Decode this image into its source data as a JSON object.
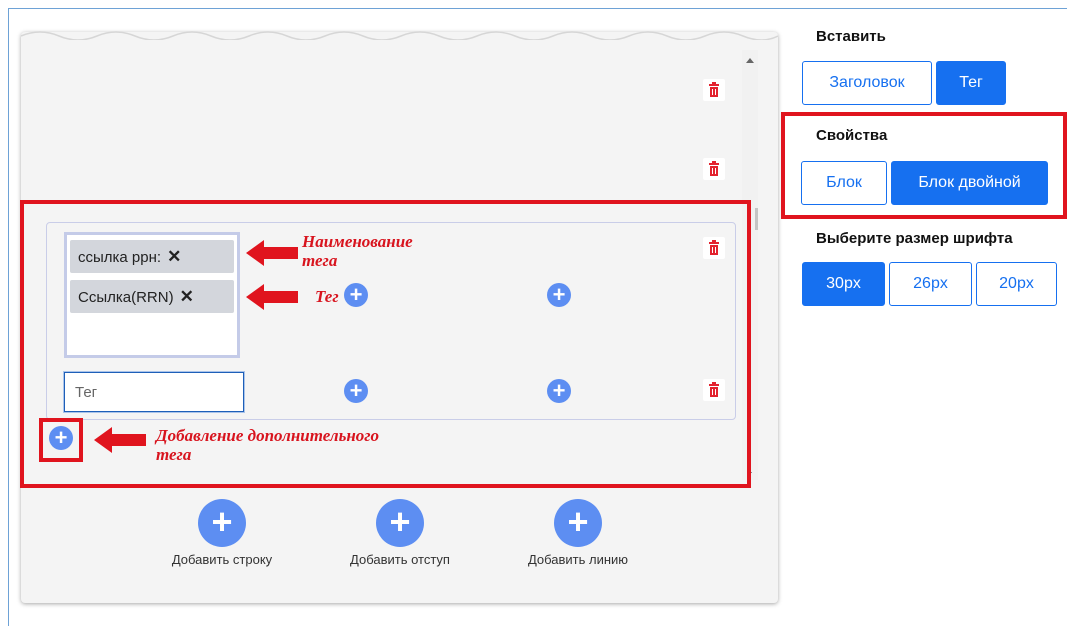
{
  "editor": {
    "row": {
      "tag_chips": [
        {
          "label": "ссылка ррн:",
          "remove": "✕"
        },
        {
          "label": "Ссылка(RRN)",
          "remove": "✕"
        }
      ],
      "tag_input_placeholder": "Тег"
    },
    "actions": [
      {
        "label": "Добавить строку",
        "icon": "+"
      },
      {
        "label": "Добавить отступ",
        "icon": "+"
      },
      {
        "label": "Добавить линию",
        "icon": "+"
      }
    ],
    "add_icon": "+"
  },
  "annotations": {
    "tag_name": [
      "Наименование",
      "тега"
    ],
    "tag": "Тег",
    "add_tag": [
      "Добавление дополнительного",
      "тега"
    ],
    "color": "#e0141e"
  },
  "panel": {
    "insert_title": "Вставить",
    "insert_buttons": [
      {
        "label": "Заголовок",
        "selected": false
      },
      {
        "label": "Тег",
        "selected": true
      }
    ],
    "props_title": "Свойства",
    "props_buttons": [
      {
        "label": "Блок",
        "selected": false
      },
      {
        "label": "Блок двойной",
        "selected": true
      }
    ],
    "font_title": "Выберите размер шрифта",
    "font_buttons": [
      {
        "label": "30px",
        "selected": true
      },
      {
        "label": "26px",
        "selected": false
      },
      {
        "label": "20px",
        "selected": false
      }
    ],
    "accent": "#1670f0"
  }
}
